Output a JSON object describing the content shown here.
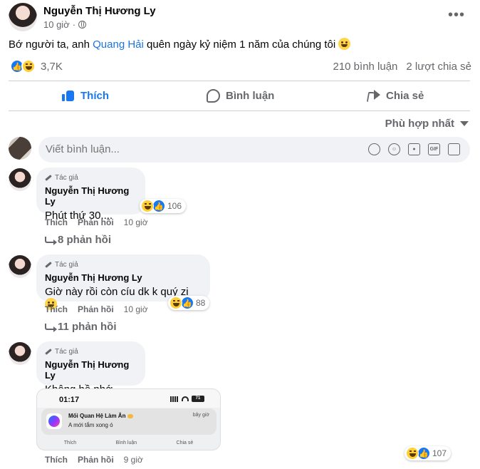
{
  "post": {
    "author": "Nguyễn Thị Hương Ly",
    "time": "10 giờ",
    "privacy_icon": "globe-icon",
    "text_before": "Bớ người ta, anh ",
    "mention": "Quang Hải",
    "text_after": " quên ngày kỷ niệm 1 năm của chúng tôi",
    "reaction_count": "3,7K",
    "comment_count": "210 bình luận",
    "share_count": "2 lượt chia sẻ"
  },
  "actions": {
    "like": "Thích",
    "comment": "Bình luận",
    "share": "Chia sẻ"
  },
  "sort_label": "Phù hợp nhất",
  "composer": {
    "placeholder": "Viết bình luận..."
  },
  "comments": [
    {
      "badge": "Tác giả",
      "author": "Nguyễn Thị Hương Ly",
      "text": "Phút thứ 30....",
      "reactions": "106",
      "like": "Thích",
      "reply": "Phản hồi",
      "time": "10 giờ",
      "replies": "8 phản hồi"
    },
    {
      "badge": "Tác giả",
      "author": "Nguyễn Thị Hương Ly",
      "text": "Giờ này rồi còn cíu dk k quý zị",
      "reactions": "88",
      "like": "Thích",
      "reply": "Phản hồi",
      "time": "10 giờ",
      "replies": "11 phản hồi"
    },
    {
      "badge": "Tác giả",
      "author": "Nguyễn Thị Hương Ly",
      "text": "Không hề nhớ ...",
      "reactions": "107",
      "like": "Thích",
      "reply": "Phản hồi",
      "time": "9 giờ"
    }
  ],
  "screenshot": {
    "time": "01:17",
    "battery": "71",
    "notif_title": "Mối Quan Hệ Làm Ăn",
    "notif_body": "A mới tắm xong ó",
    "notif_time": "bây giờ",
    "like": "Thích",
    "comment": "Bình luận",
    "share": "Chia sẻ"
  },
  "colors": {
    "accent": "#1877f2",
    "mention": "#1b74e4",
    "secondary_text": "#65676b",
    "bubble_bg": "#f0f2f5"
  }
}
